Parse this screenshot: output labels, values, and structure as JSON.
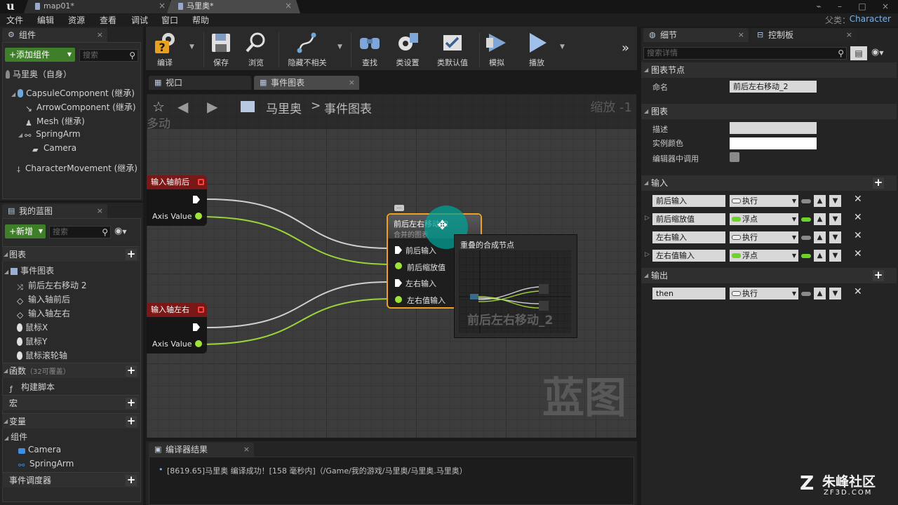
{
  "tabstrip": {
    "tabs": [
      {
        "label": "map01*",
        "active": false
      },
      {
        "label": "马里奥*",
        "active": true
      }
    ]
  },
  "menubar": {
    "items": [
      "文件",
      "编辑",
      "资源",
      "查看",
      "调试",
      "窗口",
      "帮助"
    ],
    "parent_label": "父类：",
    "parent_value": "Character"
  },
  "components_panel": {
    "tab_label": "组件",
    "add_button": "+添加组件",
    "search_placeholder": "搜索",
    "self_label": "马里奥（自身）",
    "tree": [
      {
        "label": "CapsuleComponent (继承)",
        "icon": "capsule-icon"
      },
      {
        "label": "ArrowComponent (继承)",
        "icon": "arrow-icon"
      },
      {
        "label": "Mesh (继承)",
        "icon": "mesh-icon"
      },
      {
        "label": "SpringArm",
        "icon": "spring-arm-icon"
      },
      {
        "label": "Camera",
        "icon": "camera-icon"
      },
      {
        "label": "CharacterMovement (继承)",
        "icon": "movement-icon"
      }
    ]
  },
  "my_blueprint": {
    "tab_label": "我的蓝图",
    "new_button": "+新增",
    "search_placeholder": "搜索",
    "graphs_label": "图表",
    "event_graph_label": "事件图表",
    "event_items": [
      "前后左右移动 2",
      "输入轴前后",
      "输入轴左右",
      "鼠标X",
      "鼠标Y",
      "鼠标滚轮轴"
    ],
    "functions_label": "函数",
    "functions_sub": "（32可覆盖）",
    "construction_script": "构建脚本",
    "macros_label": "宏",
    "variables_label": "变量",
    "components_group": "组件",
    "variable_items": [
      "Camera",
      "SpringArm"
    ],
    "dispatchers_label": "事件调度器"
  },
  "toolbar": {
    "buttons": [
      {
        "label": "编译",
        "icon": "compile-icon"
      },
      {
        "label": "保存",
        "icon": "save-icon"
      },
      {
        "label": "浏览",
        "icon": "browse-icon"
      },
      {
        "label": "隐藏不相关",
        "icon": "hide-unrelated-icon"
      },
      {
        "label": "查找",
        "icon": "find-icon"
      },
      {
        "label": "类设置",
        "icon": "class-settings-icon"
      },
      {
        "label": "类默认值",
        "icon": "class-defaults-icon"
      },
      {
        "label": "模拟",
        "icon": "simulate-icon"
      },
      {
        "label": "播放",
        "icon": "play-icon"
      }
    ],
    "overflow": "»"
  },
  "editor_tabs": [
    {
      "label": "视口",
      "active": false
    },
    {
      "label": "事件图表",
      "active": true
    }
  ],
  "graph": {
    "breadcrumb_root": "马里奥",
    "breadcrumb_sep": ">",
    "breadcrumb_leaf": "事件图表",
    "zoom_label": "缩放 -1",
    "overlay_partial": "多动",
    "watermark": "蓝图",
    "node_axis_forward": {
      "title": "输入轴前后",
      "pin": "Axis Value"
    },
    "node_axis_right": {
      "title": "输入轴左右",
      "pin": "Axis Value"
    },
    "collapsed_node": {
      "title": "前后左右移动_2",
      "subtitle": "合并的图表",
      "comment_bubble": "...",
      "pins": [
        "前后输入",
        "前后缩放值",
        "左右输入",
        "左右值输入"
      ]
    },
    "tooltip": {
      "title": "重叠的合成节点",
      "preview_caption": "前后左右移动_2"
    }
  },
  "details": {
    "tabs": [
      {
        "label": "细节",
        "icon": "details-icon"
      },
      {
        "label": "控制板",
        "icon": "palette-icon"
      }
    ],
    "search_placeholder": "搜索详情",
    "section_graph_node": "图表节点",
    "name_label": "命名",
    "name_value": "前后左右移动_2",
    "section_graph": "图表",
    "description_label": "描述",
    "description_value": "",
    "instance_color_label": "实例颜色",
    "call_in_editor_label": "编辑器中调用",
    "section_inputs": "输入",
    "inputs": [
      {
        "name": "前后输入",
        "type": "执行",
        "kind": "exec"
      },
      {
        "name": "前后缩放值",
        "type": "浮点",
        "kind": "float"
      },
      {
        "name": "左右输入",
        "type": "执行",
        "kind": "exec"
      },
      {
        "name": "左右值输入",
        "type": "浮点",
        "kind": "float"
      }
    ],
    "section_outputs": "输出",
    "outputs": [
      {
        "name": "then",
        "type": "执行",
        "kind": "exec"
      }
    ]
  },
  "compiler": {
    "tab_label": "编译器结果",
    "message": "[8619.65]马里奥 编译成功！[158 毫秒内]（/Game/我的游戏/马里奥/马里奥.马里奥）"
  },
  "site_watermark": {
    "line1": "朱峰社区",
    "line2": "ZF3D.COM"
  },
  "colors": {
    "exec": "#e6e6e6",
    "float": "#a0e23a",
    "event_header": "#8a1c1c",
    "selection": "#f0a020",
    "accent_blue": "#7fb2e6"
  }
}
